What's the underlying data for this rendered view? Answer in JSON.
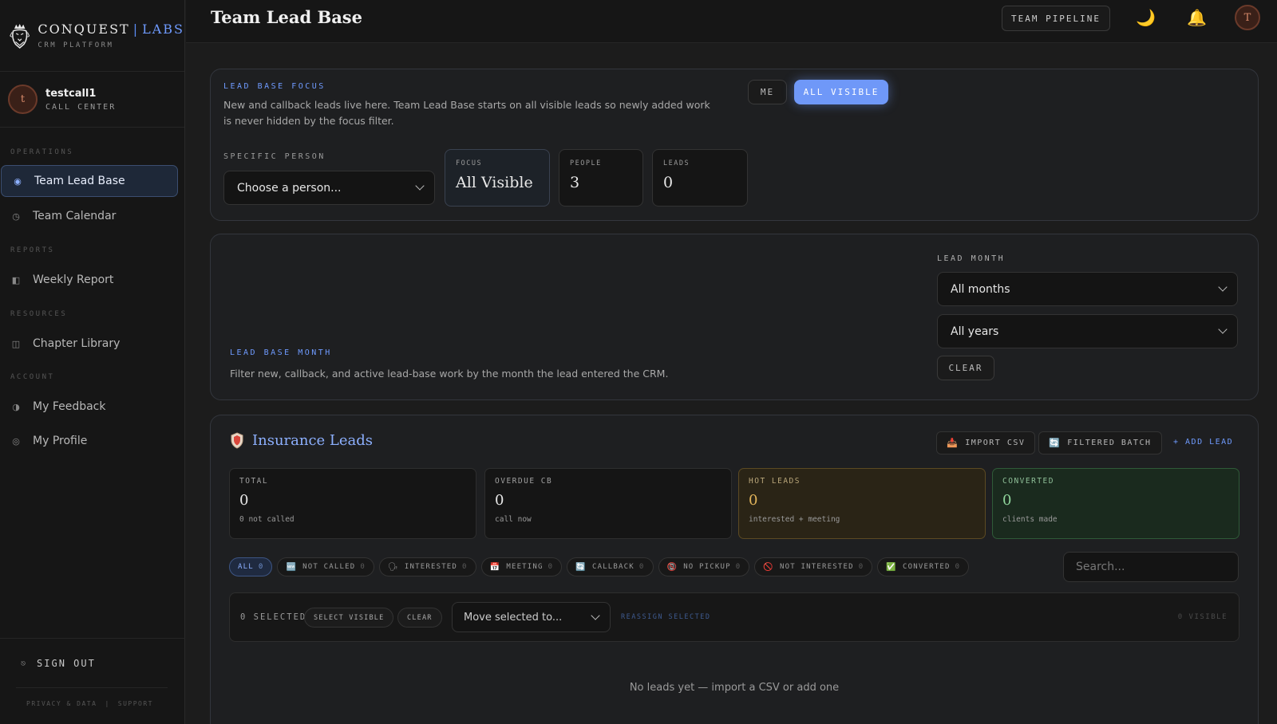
{
  "brand": {
    "name_left": "CONQUEST",
    "separator": "|",
    "name_right": "LABS",
    "subtitle": "CRM PLATFORM",
    "accent_color": "#6f9bff"
  },
  "user": {
    "initial": "t",
    "name": "testcall1",
    "role": "CALL CENTER"
  },
  "sidebar": {
    "sections": [
      {
        "label": "OPERATIONS"
      },
      {
        "label": "REPORTS"
      },
      {
        "label": "RESOURCES"
      },
      {
        "label": "ACCOUNT"
      }
    ],
    "items": [
      {
        "label": "Team Lead Base",
        "icon": "radio-dot-icon",
        "glyph": "◉",
        "active": true
      },
      {
        "label": "Team Calendar",
        "icon": "clock-icon",
        "glyph": "◷"
      },
      {
        "label": "Weekly Report",
        "icon": "report-icon",
        "glyph": "◧"
      },
      {
        "label": "Chapter Library",
        "icon": "library-icon",
        "glyph": "◫"
      },
      {
        "label": "My Feedback",
        "icon": "half-circle-icon",
        "glyph": "◑"
      },
      {
        "label": "My Profile",
        "icon": "profile-ring-icon",
        "glyph": "◎"
      }
    ],
    "signout_label": "SIGN OUT",
    "signout_glyph": "⎋",
    "footer_links": [
      "PRIVACY & DATA",
      "|",
      "SUPPORT"
    ]
  },
  "topbar": {
    "title": "Team Lead Base",
    "pipeline_label": "TEAM PIPELINE",
    "theme_glyph": "🌙",
    "bell_glyph": "🔔",
    "avatar_initial": "T"
  },
  "focus_panel": {
    "eyebrow": "LEAD BASE FOCUS",
    "description": "New and callback leads live here. Team Lead Base starts on all visible leads so newly added work is never hidden by the focus filter.",
    "toggle_me": "ME",
    "toggle_all": "ALL VISIBLE",
    "person_label": "SPECIFIC PERSON",
    "person_placeholder": "Choose a person...",
    "stats": [
      {
        "label": "FOCUS",
        "value": "All Visible"
      },
      {
        "label": "PEOPLE",
        "value": "3"
      },
      {
        "label": "LEADS",
        "value": "0"
      }
    ]
  },
  "month_panel": {
    "eyebrow": "LEAD BASE MONTH",
    "description": "Filter new, callback, and active lead-base work by the month the lead entered the CRM.",
    "month_label": "LEAD MONTH",
    "month_value": "All months",
    "year_value": "All years",
    "clear_label": "CLEAR"
  },
  "insurance": {
    "title": "Insurance Leads",
    "import_label": "IMPORT CSV",
    "import_glyph": "📥",
    "batch_label": "FILTERED BATCH",
    "batch_glyph": "🔄",
    "add_label": "+ ADD LEAD",
    "kpis": [
      {
        "label": "TOTAL",
        "value": "0",
        "sub": "0 not called"
      },
      {
        "label": "OVERDUE CB",
        "value": "0",
        "sub": "call now"
      },
      {
        "label": "HOT LEADS",
        "value": "0",
        "sub": "interested + meeting"
      },
      {
        "label": "CONVERTED",
        "value": "0",
        "sub": "clients made"
      }
    ],
    "chips": [
      {
        "label": "ALL",
        "count": "0",
        "glyph": ""
      },
      {
        "label": "NOT CALLED",
        "count": "0",
        "glyph": "🆕"
      },
      {
        "label": "INTERESTED",
        "count": "0",
        "glyph": "🗣"
      },
      {
        "label": "MEETING",
        "count": "0",
        "glyph": "📅"
      },
      {
        "label": "CALLBACK",
        "count": "0",
        "glyph": "🔄"
      },
      {
        "label": "NO PICKUP",
        "count": "0",
        "glyph": "📵"
      },
      {
        "label": "NOT INTERESTED",
        "count": "0",
        "glyph": "🚫"
      },
      {
        "label": "CONVERTED",
        "count": "0",
        "glyph": "✅"
      }
    ],
    "search_placeholder": "Search...",
    "bulk": {
      "selected_label": "0 SELECTED",
      "select_visible": "SELECT VISIBLE",
      "clear": "CLEAR",
      "move_placeholder": "Move selected to...",
      "reassign": "REASSIGN SELECTED",
      "visible_count": "0 VISIBLE"
    },
    "empty_message": "No leads yet — import a CSV or add one"
  }
}
